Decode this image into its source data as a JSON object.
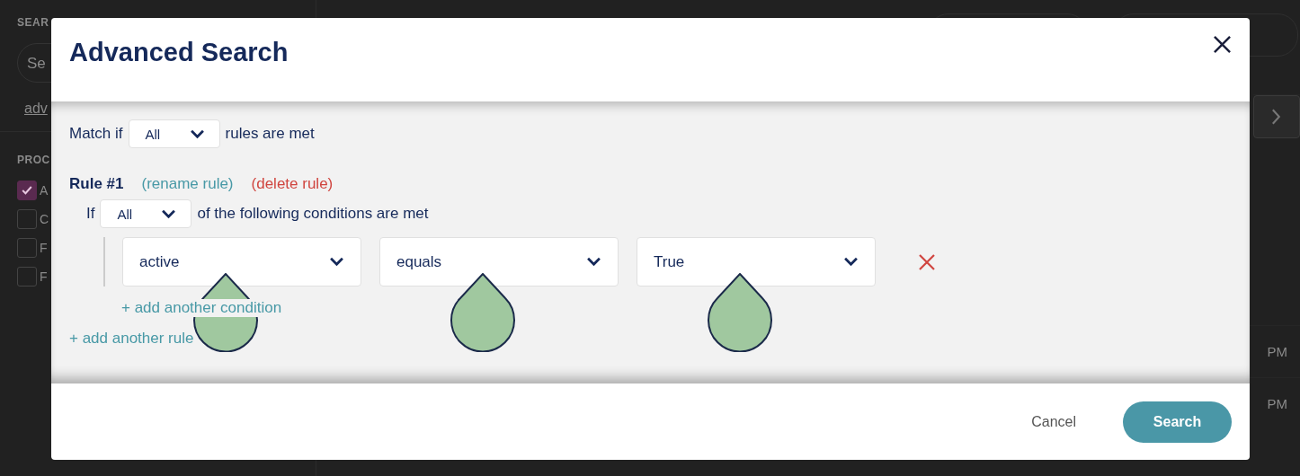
{
  "background": {
    "sidebar": {
      "search_heading": "SEAR",
      "search_placeholder": "Se",
      "advanced_link": "adv",
      "filter_heading": "PROC",
      "filters": [
        {
          "label": "A",
          "checked": true
        },
        {
          "label": "C",
          "checked": false
        },
        {
          "label": "F",
          "checked": false
        },
        {
          "label": "F",
          "checked": false
        }
      ]
    },
    "times": [
      "PM",
      "PM"
    ]
  },
  "dialog": {
    "title": "Advanced Search",
    "match": {
      "prefix": "Match if",
      "value": "All",
      "suffix": "rules are met"
    },
    "rules": [
      {
        "title": "Rule #1",
        "rename": "(rename rule)",
        "delete": "(delete rule)",
        "prefix": "If",
        "value": "All",
        "suffix": "of the following conditions are met",
        "conditions": [
          {
            "field": "active",
            "operator": "equals",
            "value": "True"
          }
        ],
        "add_condition": "+ add another condition"
      }
    ],
    "add_rule": "+ add another rule",
    "cancel": "Cancel",
    "submit": "Search"
  }
}
